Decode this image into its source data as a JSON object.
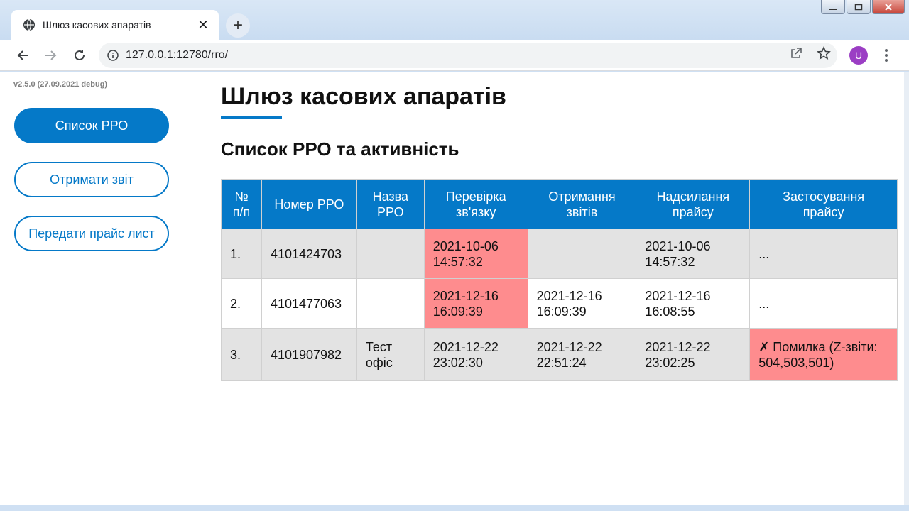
{
  "browser": {
    "tab_title": "Шлюз касових апаратів",
    "tab_close": "✕",
    "new_tab": "+",
    "url": "127.0.0.1:12780/rro/",
    "avatar_letter": "U",
    "icons": [
      "globe-icon",
      "back-icon",
      "forward-icon",
      "reload-icon",
      "info-icon",
      "share-icon",
      "star-icon",
      "menu-icon"
    ]
  },
  "sidebar": {
    "version": "v2.5.0 (27.09.2021 debug)",
    "items": [
      {
        "label": "Список РРО",
        "active": true
      },
      {
        "label": "Отримати звіт",
        "active": false
      },
      {
        "label": "Передати прайс лист",
        "active": false
      }
    ]
  },
  "main": {
    "title": "Шлюз касових апаратів",
    "subtitle": "Список РРО та активність",
    "table": {
      "headers": [
        "№\nп/п",
        "Номер РРО",
        "Назва\nРРО",
        "Перевірка\nзв'язку",
        "Отримання\nзвітів",
        "Надсилання\nпрайсу",
        "Застосування\nпрайсу"
      ],
      "rows": [
        {
          "num": "1.",
          "rro": "4101424703",
          "name": "",
          "check": "2021-10-06\n14:57:32",
          "reports": "",
          "send": "2021-10-06\n14:57:32",
          "apply": "..."
        },
        {
          "num": "2.",
          "rro": "4101477063",
          "name": "",
          "check": "2021-12-16\n16:09:39",
          "reports": "2021-12-16\n16:09:39",
          "send": "2021-12-16\n16:08:55",
          "apply": "..."
        },
        {
          "num": "3.",
          "rro": "4101907982",
          "name": "Тест\nофіс",
          "check": "2021-12-22\n23:02:30",
          "reports": "2021-12-22\n22:51:24",
          "send": "2021-12-22\n23:02:25",
          "apply": "✗ Помилка (Z-звіти:\n504,503,501)"
        }
      ]
    }
  },
  "colors": {
    "accent": "#0579c8",
    "error_cell": "#fe8c8e",
    "row_alt": "#e3e3e3"
  }
}
